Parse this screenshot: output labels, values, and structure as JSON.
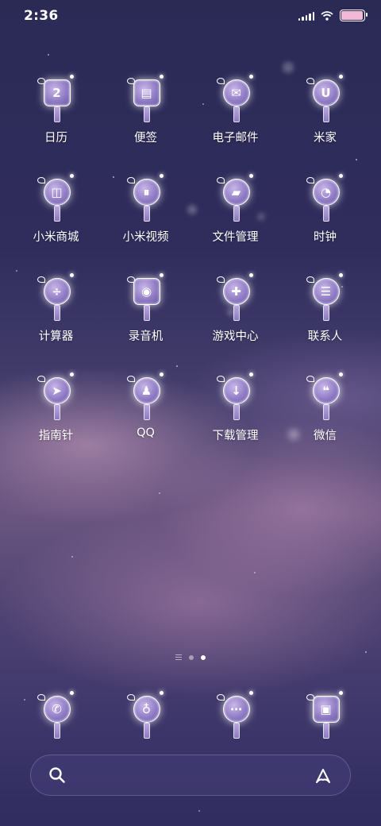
{
  "status_bar": {
    "time": "2:36",
    "battery_level": 0.95
  },
  "apps": [
    {
      "label": "日历",
      "icon": "calendar-icon",
      "glyph": "2"
    },
    {
      "label": "便签",
      "icon": "notes-icon",
      "glyph": "▤"
    },
    {
      "label": "电子邮件",
      "icon": "email-icon",
      "glyph": "✉"
    },
    {
      "label": "米家",
      "icon": "mijia-icon",
      "glyph": "U"
    },
    {
      "label": "小米商城",
      "icon": "store-bag-icon",
      "glyph": "◫"
    },
    {
      "label": "小米视频",
      "icon": "video-icon",
      "glyph": "⏸"
    },
    {
      "label": "文件管理",
      "icon": "folder-icon",
      "glyph": "▰"
    },
    {
      "label": "时钟",
      "icon": "clock-icon",
      "glyph": "◔"
    },
    {
      "label": "计算器",
      "icon": "calculator-icon",
      "glyph": "÷"
    },
    {
      "label": "录音机",
      "icon": "recorder-icon",
      "glyph": "◉"
    },
    {
      "label": "游戏中心",
      "icon": "gamepad-icon",
      "glyph": "✚"
    },
    {
      "label": "联系人",
      "icon": "contacts-icon",
      "glyph": "☰"
    },
    {
      "label": "指南针",
      "icon": "compass-icon",
      "glyph": "➤"
    },
    {
      "label": "QQ",
      "icon": "qq-penguin-icon",
      "glyph": "♟"
    },
    {
      "label": "下载管理",
      "icon": "download-cloud-icon",
      "glyph": "↓"
    },
    {
      "label": "微信",
      "icon": "wechat-icon",
      "glyph": "❝"
    }
  ],
  "dock": [
    {
      "icon": "phone-icon",
      "glyph": "✆"
    },
    {
      "icon": "browser-planet-icon",
      "glyph": "♁"
    },
    {
      "icon": "messages-icon",
      "glyph": "⋯"
    },
    {
      "icon": "gallery-icon",
      "glyph": "▣"
    }
  ],
  "page_indicator": {
    "pages": 2,
    "active_index": 1
  },
  "search_bar": {
    "search_icon": "search-icon",
    "assistant_icon": "ai-assistant-icon"
  }
}
